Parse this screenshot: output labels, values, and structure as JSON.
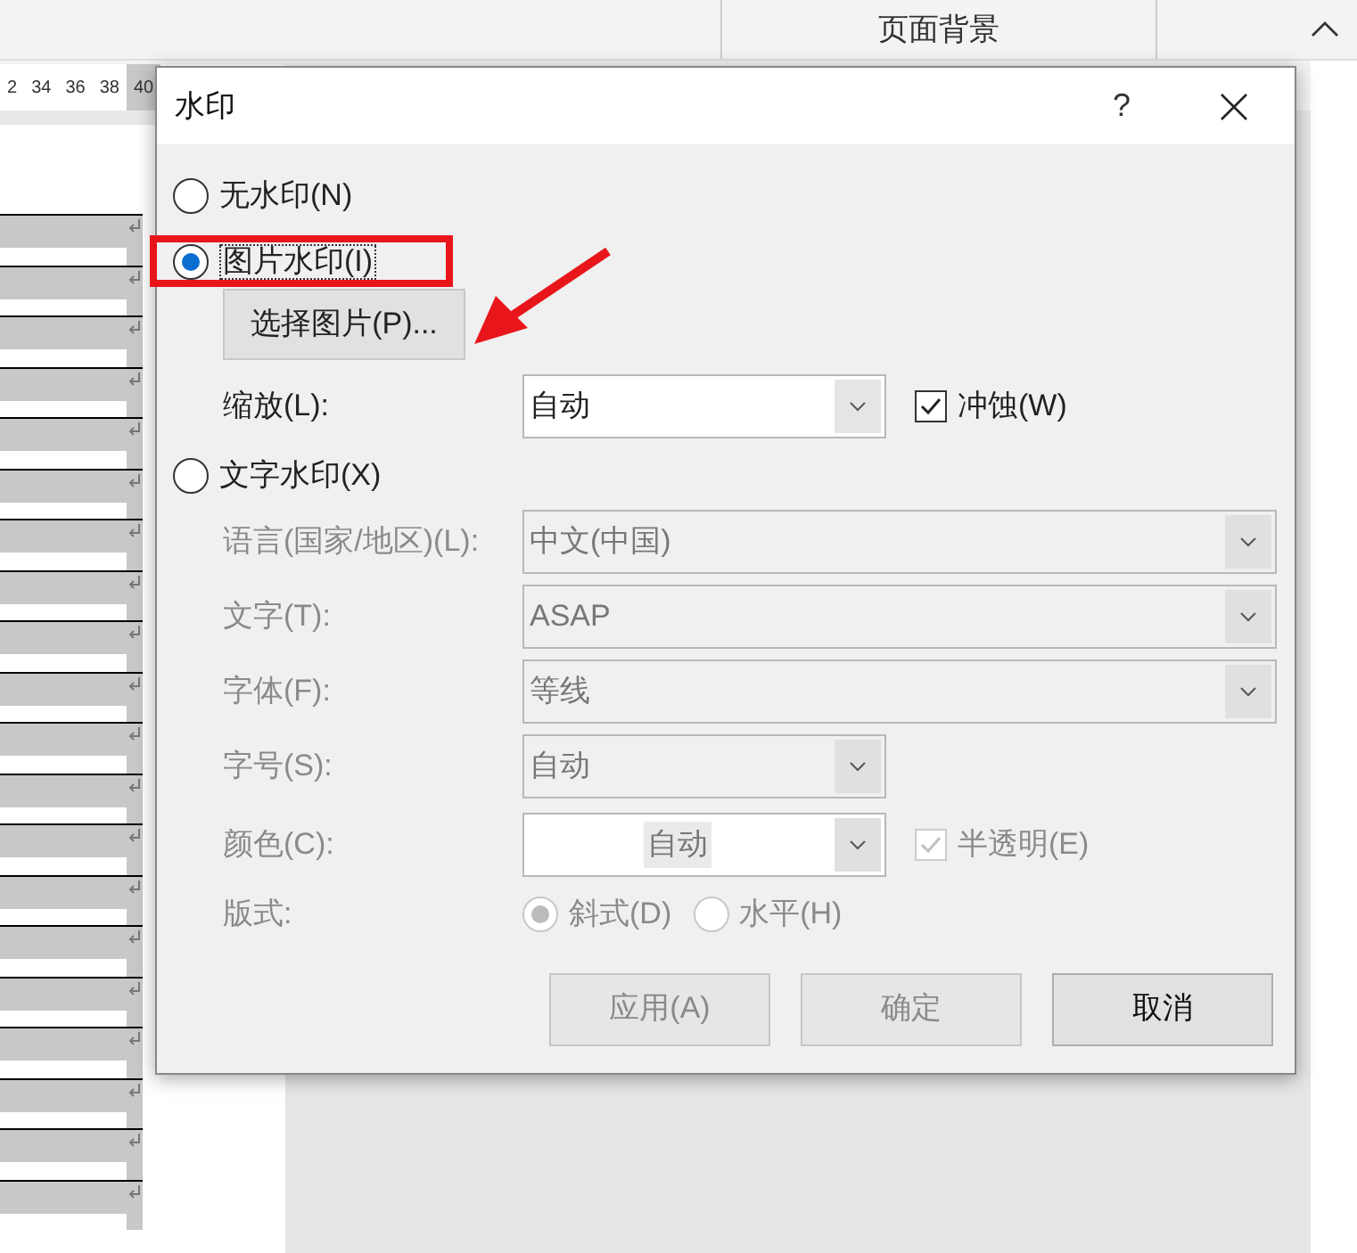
{
  "ribbon": {
    "group_label": "页面背景"
  },
  "ruler": [
    "2",
    "34",
    "36",
    "38",
    "40"
  ],
  "dialog": {
    "title": "水印",
    "help": "?",
    "no_watermark": {
      "label": "无水印(N)",
      "selected": false
    },
    "picture_watermark": {
      "label": "图片水印(I)",
      "selected": true,
      "select_button": "选择图片(P)...",
      "scale": {
        "label": "缩放(L):",
        "value": "自动"
      },
      "washout": {
        "label": "冲蚀(W)",
        "checked": true
      }
    },
    "text_watermark": {
      "label": "文字水印(X)",
      "selected": false,
      "disabled": true,
      "fields": [
        {
          "label": "语言(国家/地区)(L):",
          "value": "中文(中国)",
          "kind": "wide"
        },
        {
          "label": "文字(T):",
          "value": "ASAP",
          "kind": "wide"
        },
        {
          "label": "字体(F):",
          "value": "等线",
          "kind": "wide"
        },
        {
          "label": "字号(S):",
          "value": "自动",
          "kind": "narrow"
        },
        {
          "label": "颜色(C):",
          "value": "自动",
          "kind": "color",
          "semi_transparent": {
            "label": "半透明(E)",
            "checked": true
          }
        }
      ],
      "layout": {
        "label": "版式:",
        "options": [
          {
            "label": "斜式(D)",
            "selected": true
          },
          {
            "label": "水平(H)",
            "selected": false
          }
        ]
      }
    },
    "buttons": [
      {
        "label": "应用(A)",
        "disabled": true
      },
      {
        "label": "确定",
        "disabled": true
      },
      {
        "label": "取消",
        "disabled": false
      }
    ]
  }
}
